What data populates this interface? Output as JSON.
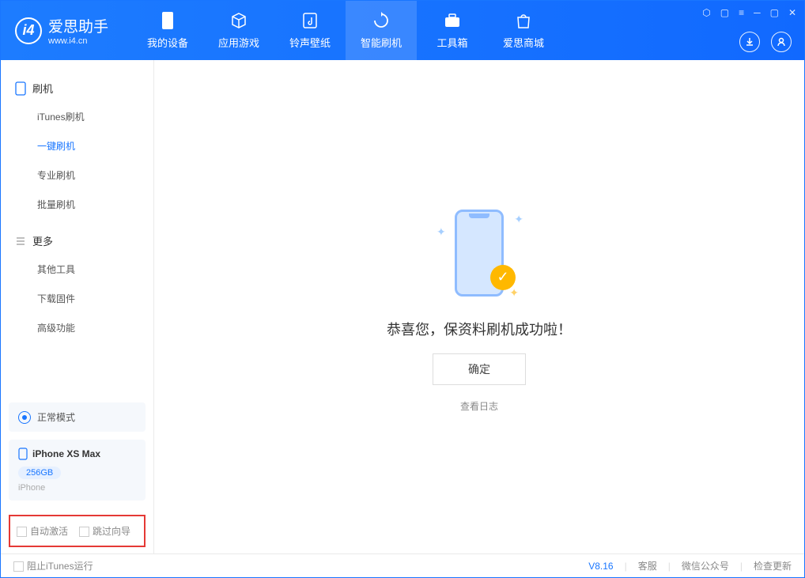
{
  "app": {
    "name": "爱思助手",
    "url": "www.i4.cn"
  },
  "nav": {
    "items": [
      {
        "label": "我的设备"
      },
      {
        "label": "应用游戏"
      },
      {
        "label": "铃声壁纸"
      },
      {
        "label": "智能刷机"
      },
      {
        "label": "工具箱"
      },
      {
        "label": "爱思商城"
      }
    ]
  },
  "sidebar": {
    "section1": {
      "title": "刷机",
      "items": [
        "iTunes刷机",
        "一键刷机",
        "专业刷机",
        "批量刷机"
      ]
    },
    "section2": {
      "title": "更多",
      "items": [
        "其他工具",
        "下载固件",
        "高级功能"
      ]
    }
  },
  "device": {
    "status": "正常模式",
    "name": "iPhone XS Max",
    "storage": "256GB",
    "type": "iPhone"
  },
  "options": {
    "auto_activate": "自动激活",
    "skip_guide": "跳过向导"
  },
  "main": {
    "success_text": "恭喜您，保资料刷机成功啦！",
    "ok_button": "确定",
    "log_link": "查看日志"
  },
  "footer": {
    "block_itunes": "阻止iTunes运行",
    "version": "V8.16",
    "support": "客服",
    "wechat": "微信公众号",
    "update": "检查更新"
  }
}
